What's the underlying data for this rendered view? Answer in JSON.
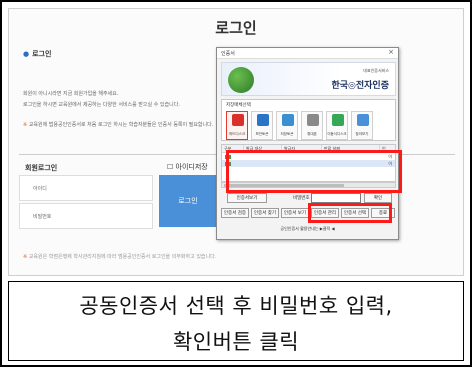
{
  "page": {
    "title": "로그인",
    "section_title": "로그인",
    "intro_line1": "회원이 아니시라면 지금 회원가입을 해주세요.",
    "intro_line2": "로그인을 하시면 교육원에서 제공하는 다양한 서비스를 받으실 수 있습니다.",
    "notice": "교육원에 법용공인인증서로 처음 로그인 하시는 학습자분들은 인증서 등록이 필요합니다.",
    "notice_star": "※",
    "login_title": "회원로그인",
    "id_label": "아이디",
    "pw_label": "비밀번호",
    "check_label": "아이디저장",
    "login_button": "로그인",
    "footer_star": "※",
    "footer_note": "교육원은 학점은행제 학사관리지침에 따라 범용공인인증서 로그인을 의무화하고 있습니다."
  },
  "dialog": {
    "title": "인증서",
    "close": "×",
    "banner_small": "대표인증서비스",
    "banner_brand": "한국◎전자인증",
    "storage_label": "저장매체선택",
    "locations": [
      {
        "name": "하드디스크",
        "icon": "harddisk-icon",
        "color": "#d9302b",
        "selected": true
      },
      {
        "name": "보안토큰",
        "icon": "token-icon",
        "color": "#2a74c8",
        "selected": false
      },
      {
        "name": "저장토큰",
        "icon": "storage-token-icon",
        "color": "#3a8fd0",
        "selected": false
      },
      {
        "name": "휴대폰",
        "icon": "phone-icon",
        "color": "#8a8a8a",
        "selected": false
      },
      {
        "name": "이동식디스크",
        "icon": "usb-icon",
        "color": "#34a853",
        "selected": false
      },
      {
        "name": "찾아보기",
        "icon": "browse-icon",
        "color": "#4a90d9",
        "selected": false
      }
    ],
    "table_headers": [
      "구분",
      "발급 대상",
      "발급자",
      "만료 날짜",
      "인"
    ],
    "rows": [
      {
        "suffix": "이",
        "selected": false
      },
      {
        "suffix": "이",
        "selected": true
      }
    ],
    "cert_view_button": "인증서보기",
    "password_label": "비밀번호",
    "confirm_button": "확인",
    "mgmt_buttons": [
      "인증서 검증",
      "인증서 찾기",
      "인증서 보기",
      "인증서 관리",
      "인증서 선택",
      "종료"
    ],
    "footer_link": "공인인증서 활용안내는 ▶클릭 ◀",
    "highlight_color": "#ff1a1a"
  },
  "caption": {
    "line1": "공동인증서 선택 후 비밀번호 입력,",
    "line2": "확인버튼 클릭"
  }
}
